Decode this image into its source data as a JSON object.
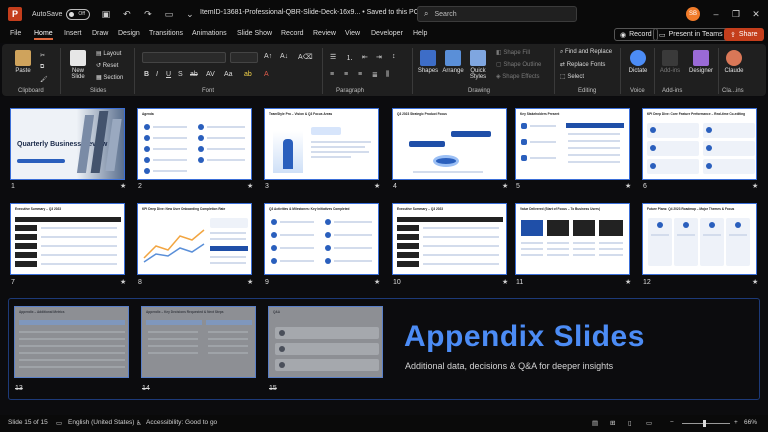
{
  "titlebar": {
    "autosave_label": "AutoSave",
    "autosave_state": "Off",
    "doc_title": "ItemID-13681-Professional-QBR-Slide-Deck-16x9...  •  Saved to this PC",
    "search_placeholder": "Search",
    "avatar_initials": "SB"
  },
  "menu": {
    "tabs": [
      "File",
      "Home",
      "Insert",
      "Draw",
      "Design",
      "Transitions",
      "Animations",
      "Slide Show",
      "Record",
      "Review",
      "View",
      "Developer",
      "Help"
    ],
    "active_tab": "Home",
    "record_label": "Record",
    "present_label": "Present in Teams",
    "share_label": "Share"
  },
  "ribbon": {
    "groups": [
      "Clipboard",
      "Slides",
      "Font",
      "Paragraph",
      "Drawing",
      "Editing",
      "Voice",
      "Add-ins",
      "Cla...ins"
    ],
    "paste": "Paste",
    "new_slide": "New Slide",
    "layout": "Layout",
    "reset": "Reset",
    "section": "Section",
    "shapes": "Shapes",
    "arrange": "Arrange",
    "quick_styles": "Quick Styles",
    "shape_fill": "Shape Fill",
    "shape_outline": "Shape Outline",
    "shape_effects": "Shape Effects",
    "find_replace": "Find and Replace",
    "replace_fonts": "Replace Fonts",
    "select": "Select",
    "dictate": "Dictate",
    "addins": "Add-ins",
    "designer": "Designer",
    "claude": "Claude"
  },
  "slides": [
    {
      "num": "1",
      "title": "Quarterly Business Review"
    },
    {
      "num": "2",
      "title": "Agenda"
    },
    {
      "num": "3",
      "title": "TeamStyle Pro – Vision & Q3 Focus Areas"
    },
    {
      "num": "4",
      "title": "Q3 2023 Strategic Product Focus"
    },
    {
      "num": "5",
      "title": "Key Stakeholders Present"
    },
    {
      "num": "6",
      "title": "KPI Deep Dive: Core Feature Performance – Real-time Co-editing"
    },
    {
      "num": "7",
      "title": "Executive Summary – Q3 2023"
    },
    {
      "num": "8",
      "title": "KPI Deep Dive: New User Onboarding Completion Rate"
    },
    {
      "num": "9",
      "title": "Q3 Activities & Milestones: Key Initiatives Completed"
    },
    {
      "num": "10",
      "title": "Executive Summary – Q3 2023"
    },
    {
      "num": "11",
      "title": "Value Delivered (Start of Focus – To Business Users)"
    },
    {
      "num": "12",
      "title": "Future Plans: Q4 2023 Roadmap – Major Themes & Focus"
    },
    {
      "num": "13",
      "title": "Appendix – Additional Metrics"
    },
    {
      "num": "14",
      "title": "Appendix – Key Decisions Requested & Next Steps"
    },
    {
      "num": "15",
      "title": "Q&A"
    }
  ],
  "appendix": {
    "title": "Appendix Slides",
    "subtitle": "Additional data, decisions & Q&A for deeper insights"
  },
  "status": {
    "slide_info": "Slide 15 of 15",
    "language": "English (United States)",
    "accessibility": "Accessibility: Good to go",
    "zoom": "66%"
  },
  "colors": {
    "accent": "#4c8cf5",
    "share": "#c43e1c",
    "tab_underline": "#e06a3f"
  }
}
